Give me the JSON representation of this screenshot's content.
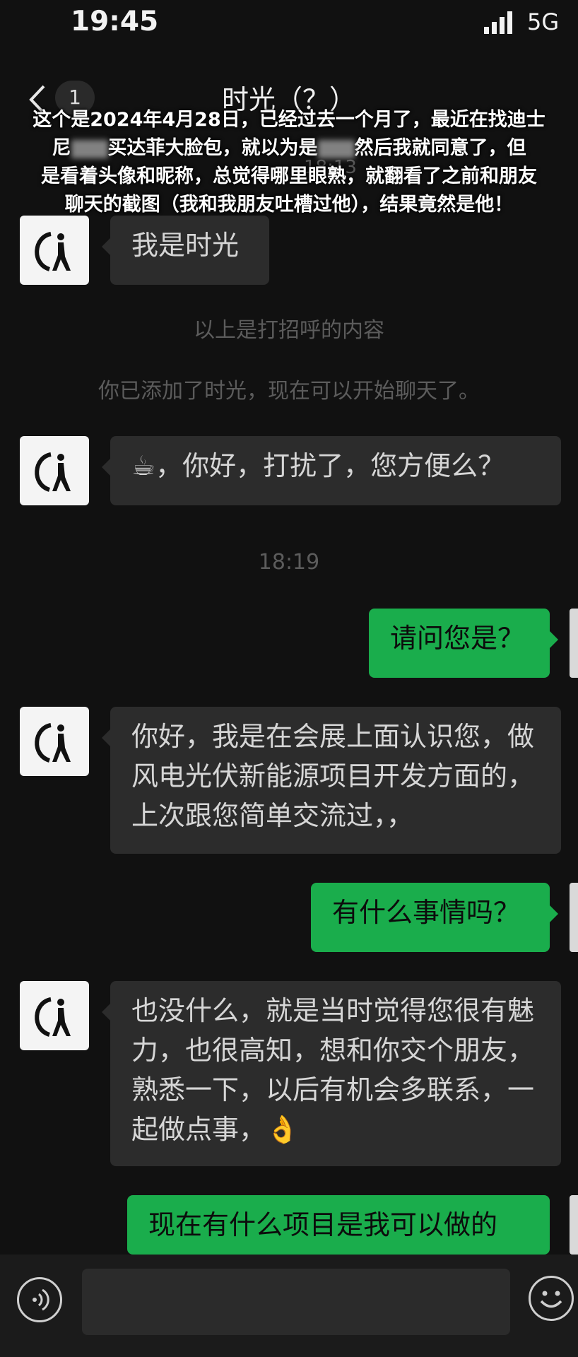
{
  "status_bar": {
    "time": "19:45",
    "network": "5G"
  },
  "nav": {
    "back_icon": "chevron-left-icon",
    "unread_count": "1",
    "title": "时光（？）"
  },
  "overlay_caption": {
    "line1": "这个是2024年4月28日，已经过去一个月了，最近在找迪士",
    "line2_a": "尼",
    "line2_b": "买达菲大脸包，就以为是",
    "line2_c": "然后我就同意了，但",
    "line3": "是看着头像和昵称，总觉得哪里眼熟，就翻看了之前和朋友",
    "line4": "聊天的截图（我和我朋友吐槽过他），结果竟然是他！"
  },
  "ghost_timestamp": "18:13",
  "messages": {
    "m1": "我是时光",
    "sys_greeting": "以上是打招呼的内容",
    "sys_added": "你已添加了时光，现在可以开始聊天了。",
    "m2": "☕，你好，打扰了，您方便么？",
    "time_1819": "18:19",
    "m3": "请问您是？",
    "m4": "你好，我是在会展上面认识您，做风电光伏新能源项目开发方面的，上次跟您简单交流过，，",
    "m5": "有什么事情吗？",
    "m6": "也没什么，就是当时觉得您很有魅力，也很高知，想和你交个朋友，熟悉一下，以后有机会多联系，一起做点事，👌",
    "m7": "现在有什么项目是我可以做的"
  },
  "input_bar": {
    "voice_icon": "voice-icon",
    "emoji_icon": "emoji-icon",
    "input_value": ""
  },
  "colors": {
    "background": "#111111",
    "sent_bubble": "#1aad4c",
    "received_bubble": "#2c2c2c"
  }
}
